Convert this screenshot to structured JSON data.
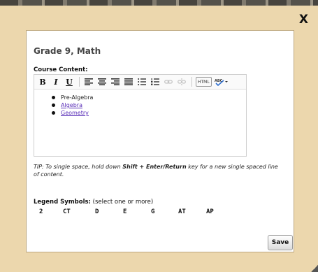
{
  "close": {
    "label": "X"
  },
  "dialog": {
    "title": "Grade 9, Math",
    "course_content_label": "Course Content:",
    "toolbar": {
      "bold": "B",
      "italic": "I",
      "underline": "U",
      "html": "HTML"
    },
    "content_items": [
      {
        "text": "Pre-Algebra"
      },
      {
        "text": "Algebra"
      },
      {
        "text": "Geometry"
      }
    ],
    "tip": {
      "prefix": "TIP: To single space, hold down ",
      "keys": "Shift + Enter/Return",
      "suffix": " key for a new single spaced line of content."
    },
    "legend": {
      "title": "Legend Symbols:",
      "hint": " (select one or more)",
      "symbols": [
        "2",
        "CT",
        "D",
        "E",
        "G",
        "AT",
        "AP"
      ]
    },
    "save_label": "Save"
  },
  "colors": {
    "frame": "#ecd7ad",
    "link": "#5a2fb8"
  }
}
